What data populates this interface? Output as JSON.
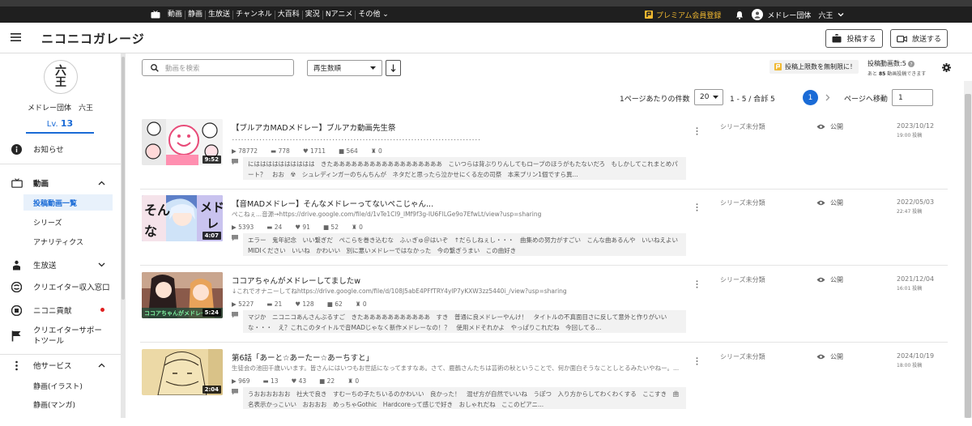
{
  "topnav": {
    "links": [
      "動画",
      "静画",
      "生放送",
      "チャンネル",
      "大百科",
      "実況",
      "Nアニメ",
      "その他"
    ],
    "premium": "プレミアム会員登録",
    "username": "メドレー団体　六王"
  },
  "header": {
    "logo": "ニコニコガレージ",
    "post_button": "投稿する",
    "live_button": "放送する"
  },
  "profile": {
    "avatar_text": "六\n王",
    "name": "メドレー団体　六王",
    "level_prefix": "Lv.",
    "level": "13"
  },
  "sidebar": {
    "notice": "お知らせ",
    "video": "動画",
    "video_sub": [
      "投稿動画一覧",
      "シリーズ",
      "アナリティクス"
    ],
    "live": "生放送",
    "creator_income": "クリエイター収入窓口",
    "niconico_contrib": "ニコニ貢献",
    "creator_support": "クリエイターサポートツール",
    "other_services": "他サービス",
    "other_sub": [
      "静画(イラスト)",
      "静画(マンガ)"
    ]
  },
  "toolbar": {
    "search_placeholder": "動画を検索",
    "sort_value": "再生数順",
    "notice": "投稿上限数を無制限に！",
    "quota_label": "投稿動画数:5",
    "quota_sub_prefix": "あと",
    "quota_remaining": "85",
    "quota_sub_suffix": "動画投稿できます"
  },
  "pager": {
    "perpage_label": "1ページあたりの件数",
    "perpage_value": "20",
    "range": "1 - 5 / 合計 5",
    "current_page": "1",
    "goto_label": "ページへ移動",
    "goto_value": "1"
  },
  "videos": [
    {
      "title": "【ブルアカMADメドレー】ブルアカ動画先生祭",
      "description": "．．．．．．．．．．．．．．．．．．．．．．．．．．．．．．．．．．．．．．．．．．．．．．．．．．．．．．．．．．．．．．．．．．．．．．．．．．．．．．．．．．",
      "duration": "9:52",
      "views": "78772",
      "comments": "778",
      "likes": "1711",
      "mylists": "564",
      "ads": "0",
      "comment_text": "にはははははははははは　きたああああああああああああああああああ　こいつらは背ぶりりんしてもロープのほうがもたないだろ　もしかしてこれまとめパート？　おお　☢　シュレディンガーのちんちんが　ネタだと思ったら泣かせにくる左の司祭　本来プリン1個ですら異...",
      "series": "シリーズ未分類",
      "visibility": "公開",
      "date": "2023/10/12",
      "time": "19:00 投稿"
    },
    {
      "title": "【音MADメドレー】そんなメドレーってないぺこじゃん...",
      "description": "ぺこねぇ...音源→https://drive.google.com/file/d/1vTe1Cl9_lMf9f3g-IU6FlLGe9o7EfwLt/view?usp=sharing",
      "duration": "4:07",
      "views": "5393",
      "comments": "24",
      "likes": "91",
      "mylists": "52",
      "ads": "0",
      "comment_text": "エラー　鬼年記念　いい繋ぎだ　ぺこらを巻き込むな　ふぃぎゅ＠はいぞ　↑だらしねぇし・・・　曲集めの努力がすごい　こんな曲あるんや　いいねえよい　MIDIください　いいね　かわいい　別に悪いメドレーではなかった　今の繋ぎうまい　この曲好き",
      "series": "シリーズ未分類",
      "visibility": "公開",
      "date": "2022/05/03",
      "time": "22:47 投稿"
    },
    {
      "title": "ココアちゃんがメドレーしてましたw",
      "description": "↓これでオナニーしてねhttps://drive.google.com/file/d/108J5abE4PFfTRY4ylP7yKXW3zz5440i_/view?usp=sharing",
      "duration": "5:24",
      "views": "5227",
      "comments": "21",
      "likes": "128",
      "mylists": "62",
      "ads": "0",
      "comment_text": "マジか　ニコニコあんさんぶるすご　きたあああああああああああ　すき　普通に良メドレーやんけ！　タイトルの不真面目さに反して意外と作りがいいな・・・　え？これこのタイトルで音MADじゃなく新作メドレーなの！？　使用メドそれかよ　やっぱりこれだね　今回してる...",
      "series": "シリーズ未分類",
      "visibility": "公開",
      "date": "2021/12/04",
      "time": "16:01 投稿"
    },
    {
      "title": "第6話「あーと☆あーたー☆あーちすと」",
      "description": "生徒会の池田千歳いいます。皆さんにはいつもお世話になってますなあ。さて、鹿鶴さんたちは芸術の秋ということで、何か面白そうなことしとるみたいやねー。...",
      "duration": "2:04",
      "views": "969",
      "comments": "13",
      "likes": "43",
      "mylists": "22",
      "ads": "0",
      "comment_text": "うおおおおおお　社大で良き　すむーちの子たちいるのかわいい　良かった！　混ぜ方が自然でいいね　うぽつ　入り方からしてわくわくする　ここすき　曲名表示かっこいい　おおおお　めっちゃGothic　Hardcoreって感じで好き　おしゃれだね　ここのピアニ...",
      "series": "シリーズ未分類",
      "visibility": "公開",
      "date": "2024/10/19",
      "time": "18:00 投稿"
    }
  ]
}
